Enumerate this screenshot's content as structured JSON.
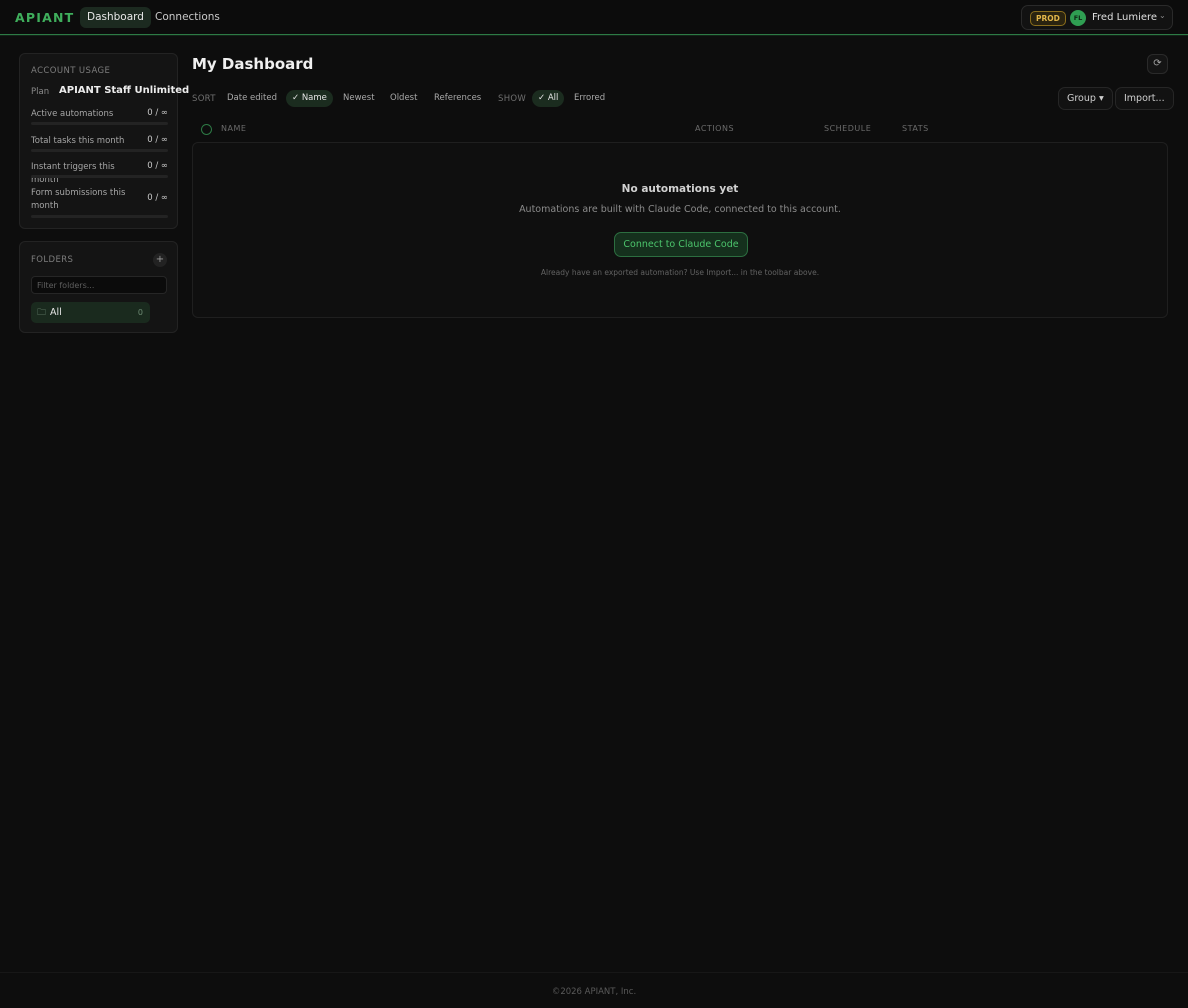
{
  "header": {
    "logo": "APIANT",
    "nav": [
      {
        "label": "Dashboard",
        "active": true
      },
      {
        "label": "Connections",
        "active": false
      }
    ],
    "env_badge": "PROD",
    "user": {
      "initials": "FL",
      "name": "Fred Lumiere",
      "menu_icon": "chevron-down-icon"
    }
  },
  "sidebar": {
    "usage": {
      "title": "ACCOUNT USAGE",
      "plan_label": "Plan",
      "plan_value": "APIANT Staff Unlimited",
      "rows": [
        {
          "label": "Active automations",
          "value": "0 / ∞",
          "fraction": 0
        },
        {
          "label": "Total tasks this month",
          "value": "0 / ∞",
          "fraction": 0
        },
        {
          "label": "Instant triggers this month",
          "value": "0 / ∞",
          "fraction": 0
        },
        {
          "label": "Form submissions this month",
          "value": "0 / ∞",
          "fraction": 0
        }
      ]
    },
    "folders": {
      "title": "FOLDERS",
      "add_icon": "plus-icon",
      "filter_placeholder": "Filter folders...",
      "items": [
        {
          "name": "All",
          "count": "0",
          "icon": "folder-icon"
        }
      ]
    }
  },
  "main": {
    "title": "My Dashboard",
    "refresh_icon": "refresh-icon",
    "sort_label": "SORT",
    "sort_options": [
      {
        "label": "Date edited",
        "active": false
      },
      {
        "label": "✓ Name",
        "active": true
      },
      {
        "label": "Newest",
        "active": false
      },
      {
        "label": "Oldest",
        "active": false
      },
      {
        "label": "References",
        "active": false
      }
    ],
    "show_label": "SHOW",
    "show_options": [
      {
        "label": "✓ All",
        "active": true
      },
      {
        "label": "Errored",
        "active": false
      }
    ],
    "group_button": "Group ▾",
    "import_button": "Import...",
    "columns": [
      "NAME",
      "ACTIONS",
      "SCHEDULE",
      "STATS"
    ],
    "empty": {
      "title": "No automations yet",
      "subtitle": "Automations are built with Claude Code, connected to this account.",
      "button": "Connect to Claude Code",
      "hint": "Already have an exported automation? Use Import... in the toolbar above."
    }
  },
  "footer": {
    "text": "©2026 APIANT, Inc."
  },
  "colors": {
    "accent": "#3fae5c",
    "background": "#0d0d0d",
    "badge": "#e2b64a"
  }
}
